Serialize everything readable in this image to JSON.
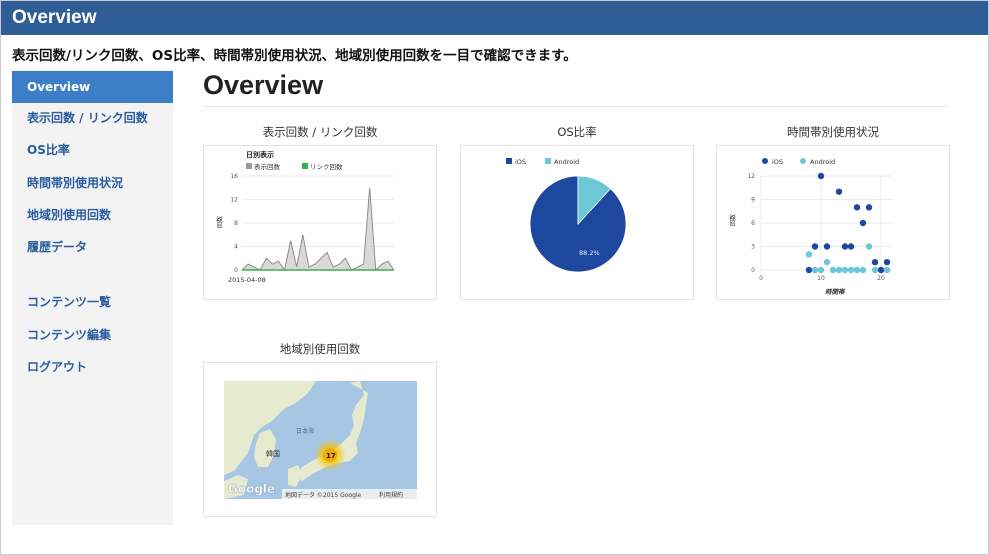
{
  "header": {
    "title": "Overview"
  },
  "tagline": "表示回数/リンク回数、OS比率、時間帯別使用状況、地域別使用回数を一目で確認できます。",
  "sidebar": {
    "items": [
      {
        "label": "Overview"
      },
      {
        "label": "表示回数 / リンク回数"
      },
      {
        "label": "OS比率"
      },
      {
        "label": "時間帯別使用状況"
      },
      {
        "label": "地域別使用回数"
      },
      {
        "label": "履歴データ"
      },
      {
        "label": "コンテンツ一覧"
      },
      {
        "label": "コンテンツ編集"
      },
      {
        "label": "ログアウト"
      }
    ]
  },
  "main": {
    "title": "Overview"
  },
  "cards": {
    "views": {
      "title": "表示回数 / リンク回数"
    },
    "os": {
      "title": "OS比率"
    },
    "hourly": {
      "title": "時間帯別使用状況"
    },
    "region": {
      "title": "地域別使用回数"
    }
  },
  "colors": {
    "header": "#2f5d96",
    "active_nav": "#3d7ec8",
    "ios": "#1e47a0",
    "android": "#6cc8d6",
    "views": "#9a9a9a",
    "links": "#3bb24a"
  },
  "chart_data": [
    {
      "type": "area",
      "title": "日別表示",
      "x": [
        "2015-04-08",
        "",
        "",
        "",
        "",
        "",
        "",
        "",
        "",
        "",
        "",
        "",
        "",
        "",
        "",
        "",
        "",
        "",
        "",
        "",
        "",
        "",
        "",
        "",
        ""
      ],
      "series": [
        {
          "name": "表示回数",
          "values": [
            0,
            1,
            0.5,
            0,
            2,
            1,
            1.5,
            0,
            5,
            0.5,
            6,
            0.5,
            1,
            2,
            3,
            0.5,
            1,
            2,
            0,
            0.5,
            1,
            14,
            0,
            1,
            1.5,
            0
          ]
        },
        {
          "name": "リンク回数",
          "values": [
            0,
            0,
            0,
            0,
            0,
            0,
            0,
            0,
            0,
            0,
            0,
            0,
            0,
            0,
            0,
            0,
            0,
            0,
            0,
            0,
            0,
            0,
            0,
            0,
            0,
            0
          ]
        }
      ],
      "xtick_labels": [
        "2015-04-08"
      ],
      "ytick_labels": [
        "0",
        "4",
        "8",
        "12",
        "16"
      ],
      "ylabel": "回数",
      "ylim": [
        0,
        16
      ],
      "legend": "top-left",
      "grid": true
    },
    {
      "type": "pie",
      "labels": [
        "iOS",
        "Android"
      ],
      "values": [
        88.2,
        11.8
      ],
      "data_labels": [
        "88.2%"
      ],
      "legend": "top"
    },
    {
      "type": "scatter",
      "series": [
        {
          "name": "iOS",
          "points": [
            [
              8,
              0
            ],
            [
              9,
              3
            ],
            [
              10,
              12
            ],
            [
              11,
              3
            ],
            [
              13,
              10
            ],
            [
              14,
              3
            ],
            [
              15,
              3
            ],
            [
              16,
              8
            ],
            [
              17,
              6
            ],
            [
              18,
              8
            ],
            [
              19,
              1
            ],
            [
              20,
              0
            ],
            [
              21,
              1
            ]
          ]
        },
        {
          "name": "Android",
          "points": [
            [
              8,
              2
            ],
            [
              9,
              0
            ],
            [
              10,
              0
            ],
            [
              11,
              1
            ],
            [
              12,
              0
            ],
            [
              13,
              0
            ],
            [
              14,
              0
            ],
            [
              15,
              0
            ],
            [
              16,
              0
            ],
            [
              17,
              0
            ],
            [
              18,
              3
            ],
            [
              19,
              0
            ],
            [
              21,
              0
            ]
          ]
        }
      ],
      "xlabel": "時間帯",
      "ylabel": "回数",
      "xtick_labels": [
        "0",
        "10",
        "20"
      ],
      "ytick_labels": [
        "0",
        "3",
        "6",
        "9",
        "12"
      ],
      "xlim": [
        0,
        22
      ],
      "ylim": [
        0,
        12
      ],
      "legend": "top",
      "grid": true
    }
  ],
  "map": {
    "labels": {
      "sea": "日本海",
      "korea": "韓国",
      "brand": "Google"
    },
    "cluster_count": "17",
    "attribution": "地図データ ©2015 Google",
    "terms": "利用規約"
  }
}
